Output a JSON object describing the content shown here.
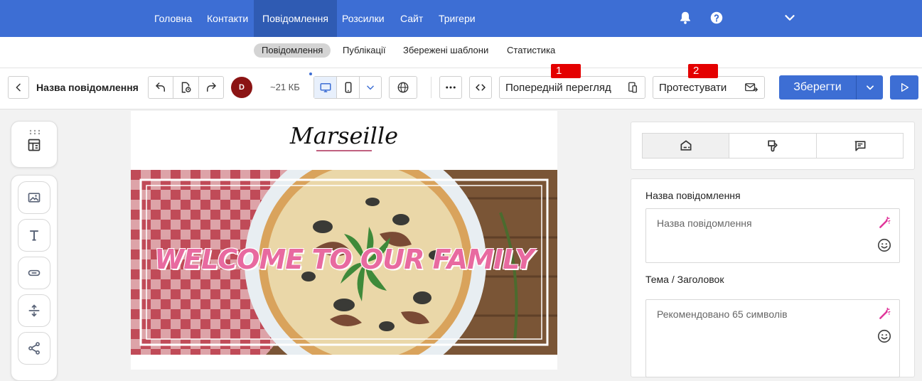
{
  "topnav": {
    "items": [
      "Головна",
      "Контакти",
      "Повідомлення",
      "Розсилки",
      "Сайт",
      "Тригери"
    ],
    "active_index": 2
  },
  "subnav": {
    "items": [
      "Повідомлення",
      "Публікації",
      "Збережені шаблони",
      "Статистика"
    ],
    "active_index": 0
  },
  "toolbar": {
    "title": "Назва повідомлення",
    "avatar_initial": "D",
    "size": "~21 КБ",
    "preview_label": "Попередній перегляд",
    "test_label": "Протестувати",
    "save_label": "Зберегти",
    "badge_1": "1",
    "badge_2": "2"
  },
  "canvas": {
    "logo_text": "Marseille",
    "hero_text": "WELCOME TO OUR FAMILY"
  },
  "right_panel": {
    "name_label": "Назва повідомлення",
    "name_placeholder": "Назва повідомлення",
    "subject_label": "Тема / Заголовок",
    "subject_placeholder": "Рекомендовано 65 символів"
  },
  "colors": {
    "primary": "#3d6ed4",
    "primary_dark": "#2f5bb3",
    "badge": "#e40000",
    "magic": "#e0359a",
    "hero_text": "#e86aa0"
  }
}
